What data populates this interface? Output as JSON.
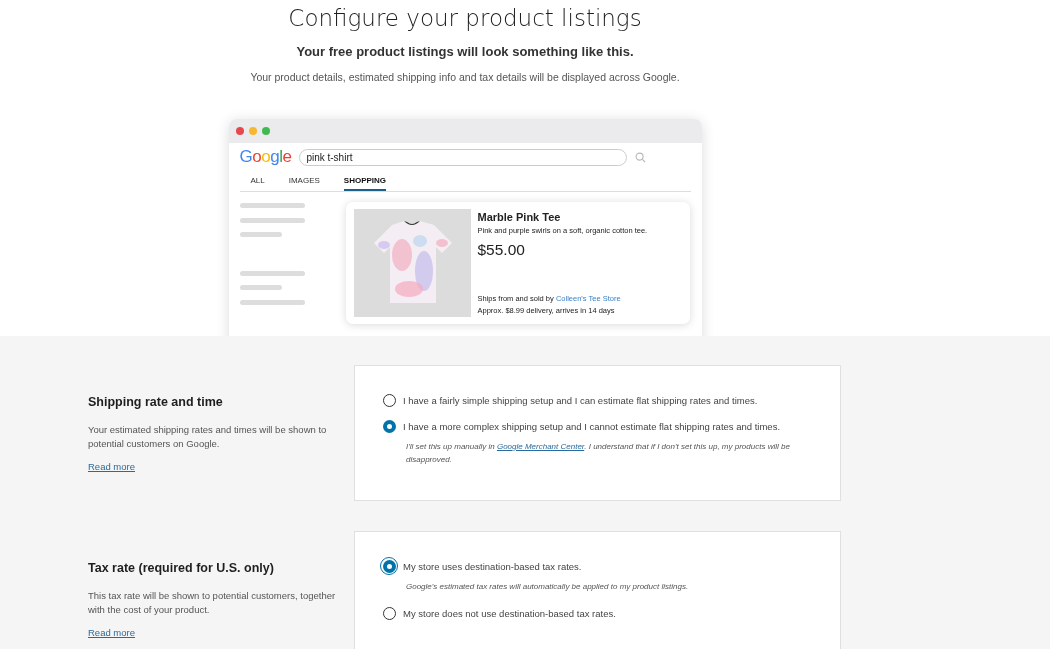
{
  "header": {
    "title": "Configure your product listings",
    "subtitle": "Your free product listings will look something like this.",
    "description": "Your product details, estimated shipping info and tax details will be displayed across Google."
  },
  "preview": {
    "logo": "Google",
    "search_value": "pink t-shirt",
    "tabs": [
      {
        "label": "ALL",
        "selected": false
      },
      {
        "label": "IMAGES",
        "selected": false
      },
      {
        "label": "SHOPPING",
        "selected": true
      }
    ],
    "product": {
      "name": "Marble Pink Tee",
      "description": "Pink and purple swirls on a soft, organic cotton tee.",
      "price": "$55.00",
      "seller_prefix": "Ships from and sold by",
      "seller": "Colleen's Tee Store",
      "delivery": "Approx. $8.99 delivery, arrives in 14 days"
    }
  },
  "sections": [
    {
      "title": "Shipping rate and time",
      "description": "Your estimated shipping rates and times will be shown to potential customers on Google.",
      "link": "Read more",
      "options": [
        {
          "label": "I have a fairly simple shipping setup and I can estimate flat shipping rates and times.",
          "selected": false,
          "focused": false
        },
        {
          "label": "I have a more complex shipping setup and I cannot estimate flat shipping rates and times.",
          "selected": true,
          "focused": false,
          "note_before": "I'll set this up manually in",
          "note_link": "Google Merchant Center",
          "note_after": ". I understand that if I don't set this up, my products will be disapproved."
        }
      ]
    },
    {
      "title": "Tax rate (required for U.S. only)",
      "description": "This tax rate will be shown to potential customers, together with the cost of your product.",
      "link": "Read more",
      "options": [
        {
          "label": "My store uses destination-based tax rates.",
          "selected": true,
          "focused": true,
          "note": "Google's estimated tax rates will automatically be applied to my product listings."
        },
        {
          "label": "My store does not use destination-based tax rates.",
          "selected": false,
          "focused": false
        }
      ]
    }
  ]
}
